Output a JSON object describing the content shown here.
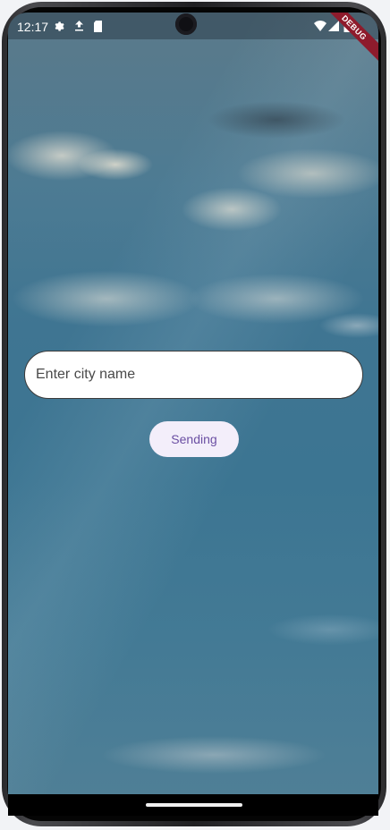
{
  "status_bar": {
    "time": "12:17",
    "icons": [
      "gear-icon",
      "download-icon",
      "sd-card-icon",
      "wifi-icon",
      "signal-icon",
      "battery-icon"
    ]
  },
  "debug_banner": {
    "label": "DEBUG"
  },
  "form": {
    "city_placeholder": "Enter city name",
    "city_value": "",
    "send_label": "Sending"
  },
  "colors": {
    "input_bg": "#ffffff",
    "button_bg": "#f3eefa",
    "button_text": "#6b4fa3",
    "banner_bg": "#8e1b2c"
  }
}
